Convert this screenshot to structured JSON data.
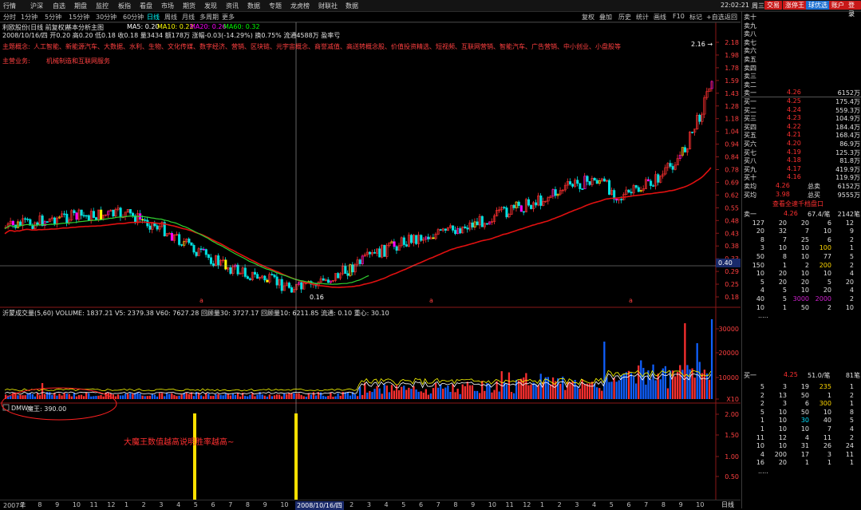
{
  "menu": [
    "行情",
    "沪深",
    "自选",
    "期盘",
    "监控",
    "板指",
    "看盘",
    "市场",
    "期货",
    "发现",
    "资讯",
    "数据",
    "专题",
    "龙虎榜",
    "财联社",
    "数据"
  ],
  "clock": "22:02:21",
  "weekday": "周三",
  "top_buttons": [
    {
      "label": "交易",
      "color": "#d02020"
    },
    {
      "label": "涨停王",
      "color": "#d02020"
    },
    {
      "label": "球优选",
      "color": "#1a6fd0"
    },
    {
      "label": "账户",
      "color": "#d02020"
    },
    {
      "label": "登录",
      "color": "#d02020"
    }
  ],
  "periods": [
    "分时",
    "1分钟",
    "5分钟",
    "15分钟",
    "30分钟",
    "60分钟",
    "日线",
    "周线",
    "月线",
    "多周期",
    "更多"
  ],
  "selected_period": "日线",
  "right_tools": [
    "复权",
    "叠加",
    "历史",
    "统计",
    "画线",
    "F10",
    "标记",
    "+自选",
    "返回"
  ],
  "stock": {
    "title": "利欧股份(日线 前复权)",
    "template": "基本分析主图",
    "ma_labels": [
      "MA5: 0.20",
      "MA10: 0.22",
      "MA20: 0.26",
      "MA60: 0.32"
    ],
    "ma_colors": [
      "#ffffff",
      "#ffff00",
      "#ff00ff",
      "#00ff00"
    ],
    "info_line": "2008/10/16/四 开0.20 高0.20 低0.18 收0.18 量3434 额178万 涨幅-0.03(-14.29%) 换0.75% 流通4588万 盈率亏",
    "concept_label": "主题概念:",
    "concepts": "人工智能、新能源汽车、大数据、水利、生物、文化传媒、数字经济、营销、区块链、元宇宙概念、商誉减值、高送转概念股、价值投资精选、短视频、互联网营销、智能汽车、广告营销、中小创业、小盘股等",
    "business_label": "主营业务:",
    "business": "机械制造和互联网服务",
    "price_labels": [
      "2.18",
      "1.98",
      "1.78",
      "1.59",
      "1.43",
      "1.28",
      "1.18",
      "1.04",
      "0.94",
      "0.84",
      "0.78",
      "0.69",
      "0.62",
      "0.55",
      "0.48",
      "0.43",
      "0.38",
      "0.33",
      "0.29",
      "0.25",
      "0.18"
    ],
    "cursor_price": "0.40",
    "high_marker": "2.16",
    "low_marker": "0.16"
  },
  "volume_panel": {
    "title": "沂蒙成交量(5,60) VOLUME: 1837.21  V5: 2379.38  V60: 7627.28  回顾量30: 3727.17  回顾量10: 6211.85  流通: 0.10  重心: 30.10",
    "labels": [
      "30000",
      "20000",
      "10000",
      "X10"
    ]
  },
  "indicator_panel": {
    "title": "DMW",
    "value_label": "魔王: 390.00",
    "annotation": "大魔王数值越高说明胜率越高~",
    "labels": [
      "2.00",
      "1.50",
      "1.00",
      "0.50"
    ]
  },
  "time_axis": {
    "labels": [
      "2007年",
      "7",
      "8",
      "9",
      "10",
      "11",
      "12",
      "1",
      "2",
      "3",
      "4",
      "5",
      "6",
      "7",
      "8",
      "9",
      "10",
      "11",
      "12",
      "2008/10/16/四",
      "2",
      "3",
      "4",
      "5",
      "6",
      "7",
      "8",
      "9",
      "10",
      "11",
      "12",
      "1",
      "2",
      "3",
      "4",
      "5",
      "6",
      "7",
      "8",
      "9",
      "10"
    ],
    "right_tab": "日线"
  },
  "order_book": {
    "sells": [
      {
        "label": "卖十",
        "price": "",
        "vol": ""
      },
      {
        "label": "卖九",
        "price": "",
        "vol": ""
      },
      {
        "label": "卖八",
        "price": "",
        "vol": ""
      },
      {
        "label": "卖七",
        "price": "",
        "vol": ""
      },
      {
        "label": "卖六",
        "price": "",
        "vol": ""
      },
      {
        "label": "卖五",
        "price": "",
        "vol": ""
      },
      {
        "label": "卖四",
        "price": "",
        "vol": ""
      },
      {
        "label": "卖三",
        "price": "",
        "vol": ""
      },
      {
        "label": "卖二",
        "price": "",
        "vol": ""
      },
      {
        "label": "卖一",
        "price": "4.26",
        "vol": "6152万"
      }
    ],
    "buys": [
      {
        "label": "买一",
        "price": "4.25",
        "vol": "175.4万"
      },
      {
        "label": "买二",
        "price": "4.24",
        "vol": "559.3万"
      },
      {
        "label": "买三",
        "price": "4.23",
        "vol": "104.9万"
      },
      {
        "label": "买四",
        "price": "4.22",
        "vol": "184.4万"
      },
      {
        "label": "买五",
        "price": "4.21",
        "vol": "168.4万"
      },
      {
        "label": "买六",
        "price": "4.20",
        "vol": "86.9万"
      },
      {
        "label": "买七",
        "price": "4.19",
        "vol": "125.3万"
      },
      {
        "label": "买八",
        "price": "4.18",
        "vol": "81.8万"
      },
      {
        "label": "买九",
        "price": "4.17",
        "vol": "419.9万"
      },
      {
        "label": "买十",
        "price": "4.16",
        "vol": "119.9万"
      }
    ],
    "avg_sell": {
      "label": "卖均",
      "price": "4.26",
      "tlabel": "总卖",
      "vol": "6152万"
    },
    "avg_buy": {
      "label": "买均",
      "price": "3.98",
      "tlabel": "总买",
      "vol": "9555万"
    },
    "queue_link": "查看全速千档盘口",
    "sell1_line": {
      "label": "卖一",
      "price": "4.26",
      "qty": "67.4/笔",
      "total": "2142笔"
    },
    "sell_queue": [
      [
        "127",
        "20",
        "20",
        "6",
        "12"
      ],
      [
        "20",
        "32",
        "7",
        "10",
        "9"
      ],
      [
        "8",
        "7",
        "25",
        "6",
        "2"
      ],
      [
        "3",
        "10",
        "10",
        "100",
        "1"
      ],
      [
        "50",
        "8",
        "10",
        "77",
        "5"
      ],
      [
        "150",
        "1",
        "2",
        "200",
        "2"
      ],
      [
        "10",
        "20",
        "10",
        "10",
        "4"
      ],
      [
        "5",
        "20",
        "20",
        "5",
        "20"
      ],
      [
        "4",
        "5",
        "10",
        "20",
        "4"
      ],
      [
        "40",
        "5",
        "3000",
        "2000",
        "2"
      ],
      [
        "10",
        "1",
        "50",
        "2",
        "10"
      ]
    ],
    "buy1_line": {
      "label": "买一",
      "price": "4.25",
      "qty": "51.0/笔",
      "total": "81笔"
    },
    "buy_queue": [
      [
        "5",
        "3",
        "19",
        "235",
        "1"
      ],
      [
        "2",
        "13",
        "50",
        "1",
        "2"
      ],
      [
        "2",
        "3",
        "6",
        "300",
        "1"
      ],
      [
        "5",
        "10",
        "50",
        "10",
        "8"
      ],
      [
        "1",
        "10",
        "30",
        "40",
        "5"
      ],
      [
        "1",
        "10",
        "10",
        "7",
        "4"
      ],
      [
        "11",
        "12",
        "4",
        "11",
        "2"
      ],
      [
        "10",
        "10",
        "31",
        "26",
        "24"
      ],
      [
        "4",
        "200",
        "17",
        "3",
        "11"
      ],
      [
        "16",
        "20",
        "1",
        "1",
        "1"
      ]
    ],
    "ellipsis": "....."
  },
  "colors": {
    "up": "#ff3030",
    "down": "#00ffff",
    "ma_red": "#e01010",
    "ma_green": "#30d030",
    "yellow": "#ffd700",
    "label_red": "#ff4040"
  }
}
